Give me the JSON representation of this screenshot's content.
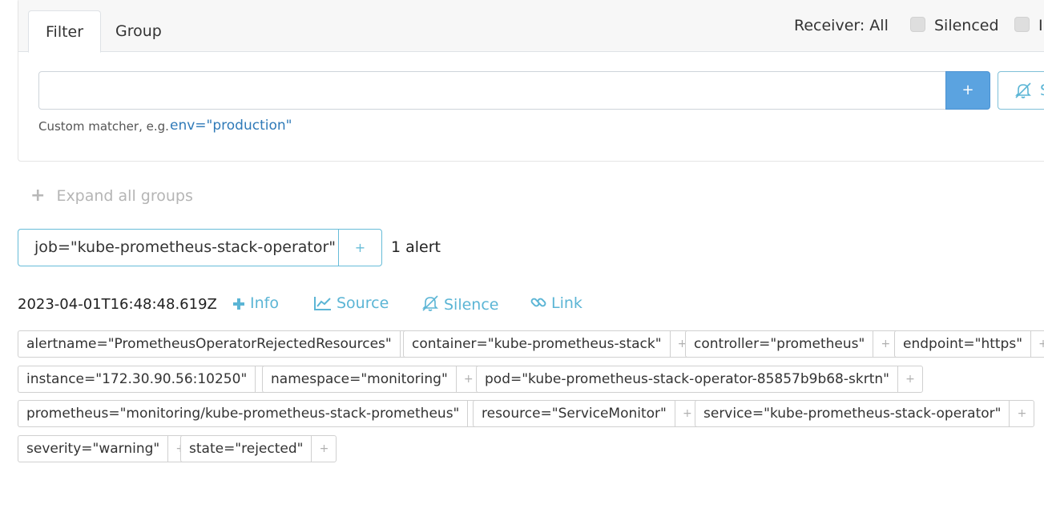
{
  "filter_panel": {
    "tabs": [
      {
        "label": "Filter",
        "active": true
      },
      {
        "label": "Group",
        "active": false
      }
    ],
    "receiver_label": "Receiver: All",
    "checkboxes": [
      {
        "label": "Silenced",
        "checked": false
      },
      {
        "label": "I",
        "checked": false
      }
    ],
    "input_value": "",
    "add_button_label": "+",
    "silence_button_label": "S",
    "hint_text": "Custom matcher, e.g.",
    "hint_example": "env=\"production\""
  },
  "expand_all": {
    "icon": "plus-icon",
    "label": "Expand all groups"
  },
  "group": {
    "label": "job=\"kube-prometheus-stack-operator\"",
    "add_label": "+",
    "alert_count": "1 alert"
  },
  "alert": {
    "timestamp": "2023-04-01T16:48:48.619Z",
    "actions": [
      {
        "icon": "plus-icon",
        "label": "Info"
      },
      {
        "icon": "chart-line-icon",
        "label": "Source"
      },
      {
        "icon": "bell-slash-icon",
        "label": "Silence"
      },
      {
        "icon": "link-icon",
        "label": "Link"
      }
    ],
    "labels": [
      "alertname=\"PrometheusOperatorRejectedResources\"",
      "container=\"kube-prometheus-stack\"",
      "controller=\"prometheus\"",
      "endpoint=\"https\"",
      "instance=\"172.30.90.56:10250\"",
      "namespace=\"monitoring\"",
      "pod=\"kube-prometheus-stack-operator-85857b9b68-skrtn\"",
      "prometheus=\"monitoring/kube-prometheus-stack-prometheus\"",
      "resource=\"ServiceMonitor\"",
      "service=\"kube-prometheus-stack-operator\"",
      "severity=\"warning\"",
      "state=\"rejected\""
    ],
    "label_add": "+"
  },
  "colors": {
    "accent": "#5bb5d5",
    "primary_button": "#5ba3e0",
    "muted": "#b5b5b5"
  }
}
